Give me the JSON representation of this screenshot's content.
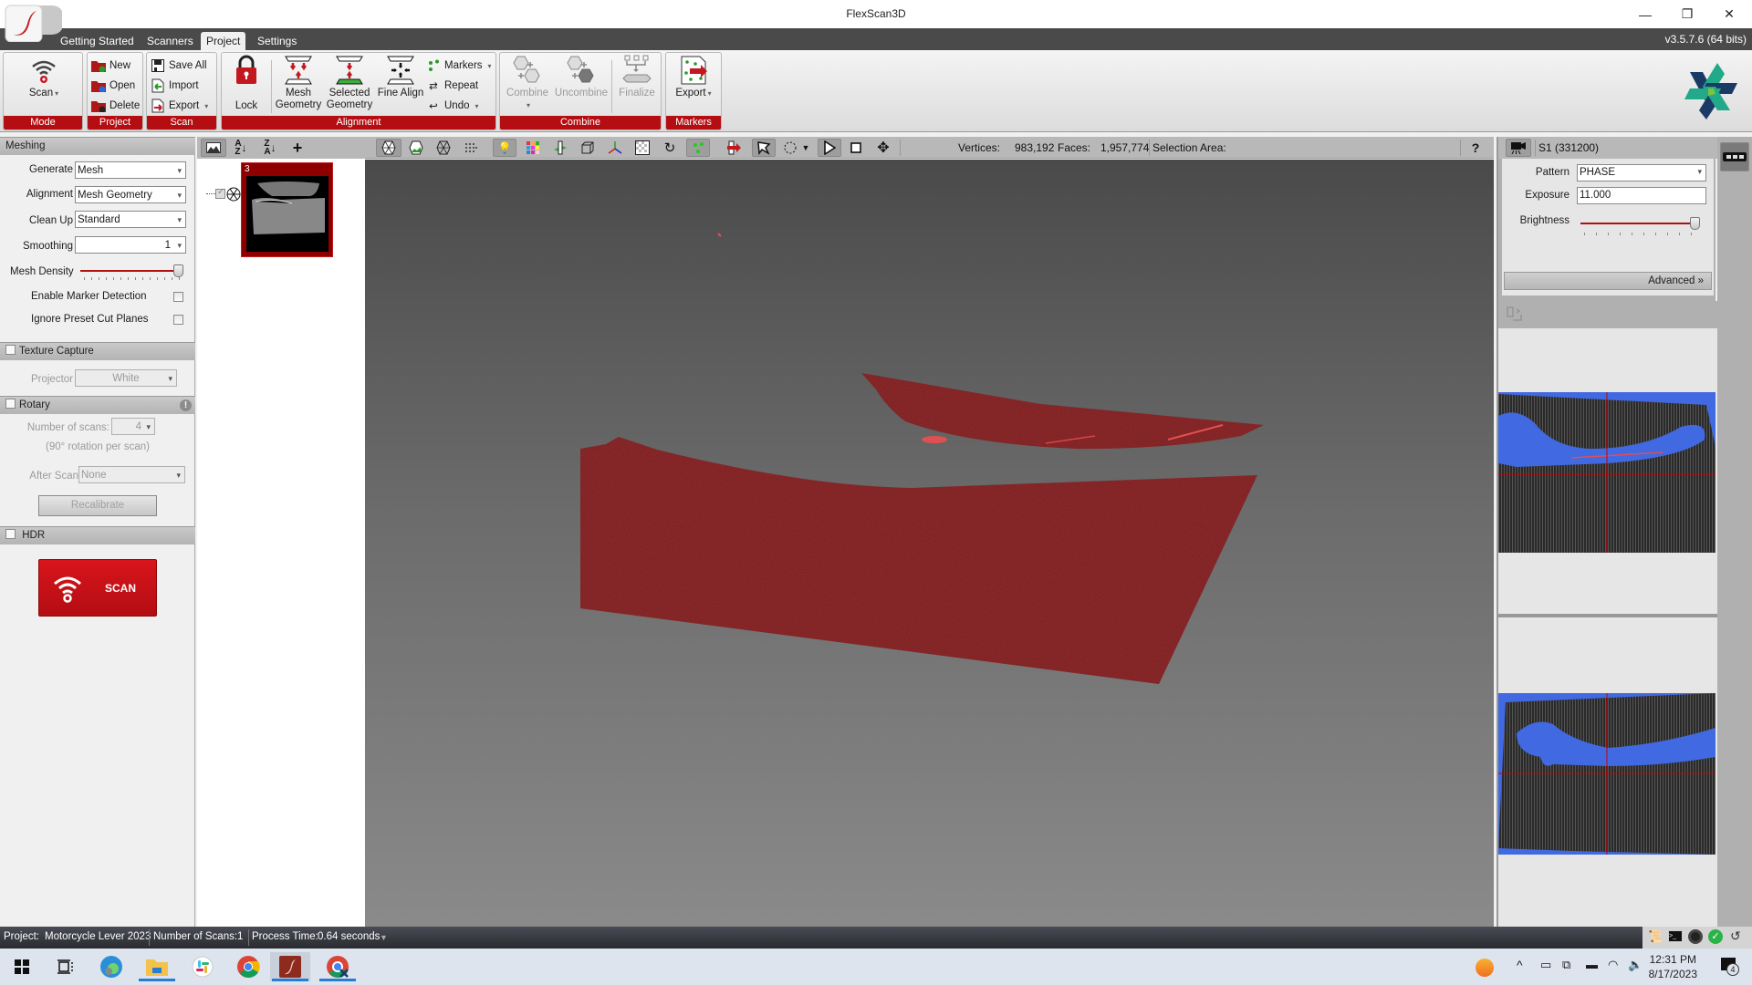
{
  "window": {
    "title": "FlexScan3D",
    "version": "v3.5.7.6  (64 bits)",
    "controls": {
      "minimize": "—",
      "restore": "❐",
      "close": "✕"
    }
  },
  "tabs": [
    {
      "label": "Getting Started",
      "active": false
    },
    {
      "label": "Scanners",
      "active": false
    },
    {
      "label": "Project",
      "active": true
    },
    {
      "label": "Settings",
      "active": false
    }
  ],
  "ribbon": {
    "groups": {
      "mode": {
        "label": "Mode",
        "scan": "Scan"
      },
      "project": {
        "label": "Project",
        "new": "New",
        "open": "Open",
        "delete": "Delete"
      },
      "scan": {
        "label": "Scan",
        "save_all": "Save All",
        "import": "Import",
        "export": "Export"
      },
      "alignment": {
        "label": "Alignment",
        "lock": "Lock",
        "mesh_geometry": "Mesh Geometry",
        "selected_geometry": "Selected Geometry",
        "fine_align": "Fine Align",
        "markers": "Markers",
        "repeat": "Repeat",
        "undo": "Undo"
      },
      "combine": {
        "label": "Combine",
        "combine": "Combine",
        "uncombine": "Uncombine",
        "finalize": "Finalize"
      },
      "markers": {
        "label": "Markers",
        "export": "Export"
      }
    }
  },
  "left_panel": {
    "meshing": {
      "title": "Meshing",
      "generate": {
        "label": "Generate",
        "value": "Mesh"
      },
      "alignment": {
        "label": "Alignment",
        "value": "Mesh Geometry"
      },
      "clean_up": {
        "label": "Clean Up",
        "value": "Standard"
      },
      "smoothing": {
        "label": "Smoothing",
        "value": "1"
      },
      "mesh_density": {
        "label": "Mesh Density",
        "level": 1.0
      },
      "enable_marker_detection": {
        "label": "Enable Marker Detection",
        "checked": false
      },
      "ignore_preset_cut_planes": {
        "label": "Ignore Preset Cut Planes",
        "checked": false
      }
    },
    "texture_capture": {
      "title": "Texture Capture",
      "checked": false,
      "projector": {
        "label": "Projector",
        "value": "White"
      }
    },
    "rotary": {
      "title": "Rotary",
      "checked": false,
      "warning_icon": "!",
      "number_of_scans": {
        "label": "Number of scans:",
        "value": "4"
      },
      "rotation_note": "(90° rotation per scan)",
      "after_scan": {
        "label": "After Scan",
        "value": "None"
      },
      "recalibrate": "Recalibrate"
    },
    "hdr": {
      "title": "HDR",
      "checked": false
    },
    "scan_button": "SCAN"
  },
  "scan_list": {
    "items": [
      {
        "number": "3",
        "checked": true
      }
    ]
  },
  "viewport": {
    "stats": {
      "vertices_label": "Vertices:",
      "vertices": "983,192",
      "faces_label": "Faces:",
      "faces": "1,957,774",
      "selection_label": "Selection Area:",
      "selection": ""
    },
    "help": "?",
    "mesh_color": "#7a1a1c",
    "background_top": "#4a4a4a",
    "background_bottom": "#8a8a8a"
  },
  "right_panel": {
    "camera": "S1 (331200)",
    "pattern": {
      "label": "Pattern",
      "value": "PHASE"
    },
    "exposure": {
      "label": "Exposure",
      "value": "11.000"
    },
    "brightness": {
      "label": "Brightness",
      "level": 1.0
    },
    "advanced": "Advanced",
    "overlay_color": "#4169e1"
  },
  "status_bar": {
    "project_label": "Project:",
    "project": "Motorcycle Lever 2023",
    "scans_label": "Number of Scans:",
    "scans": "1",
    "process_label": "Process Time:",
    "process": "0.64 seconds"
  },
  "taskbar": {
    "time": "12:31 PM",
    "date": "8/17/2023",
    "notifications": "4"
  },
  "colors": {
    "accent_red": "#b40e12",
    "tab_strip": "#4a4a4a"
  }
}
